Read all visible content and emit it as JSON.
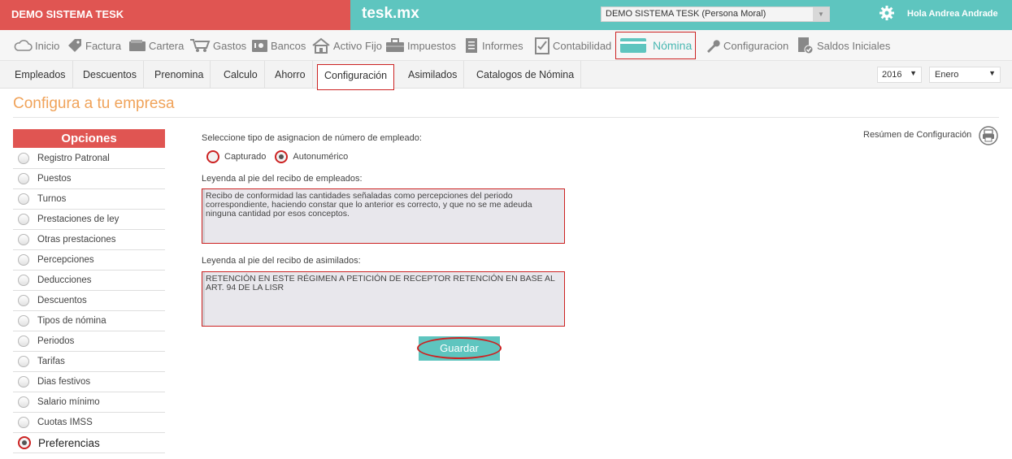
{
  "topbar": {
    "company": "DEMO SISTEMA TESK",
    "brand": "tesk.mx",
    "company_selector": "DEMO SISTEMA TESK (Persona Moral)",
    "greeting": "Hola Andrea Andrade",
    "colors": {
      "left": "#e05552",
      "right": "#5ec5bf"
    }
  },
  "main_menu": [
    {
      "label": "Inicio",
      "icon": "cloud-icon"
    },
    {
      "label": "Factura",
      "icon": "tag-icon"
    },
    {
      "label": "Cartera",
      "icon": "wallet-icon"
    },
    {
      "label": "Gastos",
      "icon": "cart-icon"
    },
    {
      "label": "Bancos",
      "icon": "safe-icon"
    },
    {
      "label": "Activo Fijo",
      "icon": "house-icon"
    },
    {
      "label": "Impuestos",
      "icon": "briefcase-icon"
    },
    {
      "label": "Informes",
      "icon": "document-icon"
    },
    {
      "label": "Contabilidad",
      "icon": "checklist-icon"
    },
    {
      "label": "Nómina",
      "icon": "card-icon",
      "active": true
    },
    {
      "label": "Configuracion",
      "icon": "wrench-icon"
    },
    {
      "label": "Saldos Iniciales",
      "icon": "doc-check-icon"
    }
  ],
  "sub_menu": [
    {
      "label": "Empleados"
    },
    {
      "label": "Descuentos"
    },
    {
      "label": "Prenomina"
    },
    {
      "label": "Calculo"
    },
    {
      "label": "Ahorro"
    },
    {
      "label": "Configuración",
      "active": true
    },
    {
      "label": "Asimilados"
    },
    {
      "label": "Catalogos de Nómina"
    }
  ],
  "period": {
    "year": "2016",
    "month": "Enero"
  },
  "page": {
    "title": "Configura a tu empresa"
  },
  "sidebar": {
    "header": "Opciones",
    "items": [
      {
        "label": "Registro Patronal"
      },
      {
        "label": "Puestos"
      },
      {
        "label": "Turnos"
      },
      {
        "label": "Prestaciones de ley"
      },
      {
        "label": "Otras prestaciones"
      },
      {
        "label": "Percepciones"
      },
      {
        "label": "Deducciones"
      },
      {
        "label": "Descuentos"
      },
      {
        "label": "Tipos de nómina"
      },
      {
        "label": "Periodos"
      },
      {
        "label": "Tarifas"
      },
      {
        "label": "Dias festivos"
      },
      {
        "label": "Salario mínimo"
      },
      {
        "label": "Cuotas IMSS"
      },
      {
        "label": "Preferencias",
        "selected": true
      }
    ]
  },
  "form": {
    "employee_number_label": "Seleccione tipo de asignacion de número de empleado:",
    "option_captured": "Capturado",
    "option_auto": "Autonumérico",
    "selected_option": "Autonumérico",
    "employees_footer_label": "Leyenda al pie del recibo de empleados:",
    "employees_footer_value": "Recibo de conformidad las cantidades señaladas como percepciones del periodo correspondiente, haciendo constar que lo anterior es correcto,  y que no se me adeuda ninguna cantidad por esos conceptos.",
    "assimilated_footer_label": "Leyenda al pie del recibo de asimilados:",
    "assimilated_footer_value": "RETENCIÓN EN ESTE RÉGIMEN A PETICIÓN DE RECEPTOR RETENCIÓN EN BASE AL ART. 94 DE LA LISR",
    "save_label": "Guardar"
  },
  "summary": {
    "label": "Resúmen de Configuración",
    "icon": "printer-icon"
  }
}
